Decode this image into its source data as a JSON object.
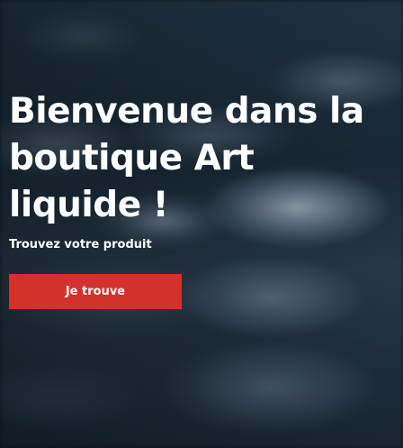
{
  "hero": {
    "title": "Bienvenue dans la boutique Art liquide !",
    "subtitle": "Trouvez votre produit",
    "cta_label": "Je trouve"
  },
  "colors": {
    "cta_background": "#d3312b",
    "text": "#ffffff"
  }
}
